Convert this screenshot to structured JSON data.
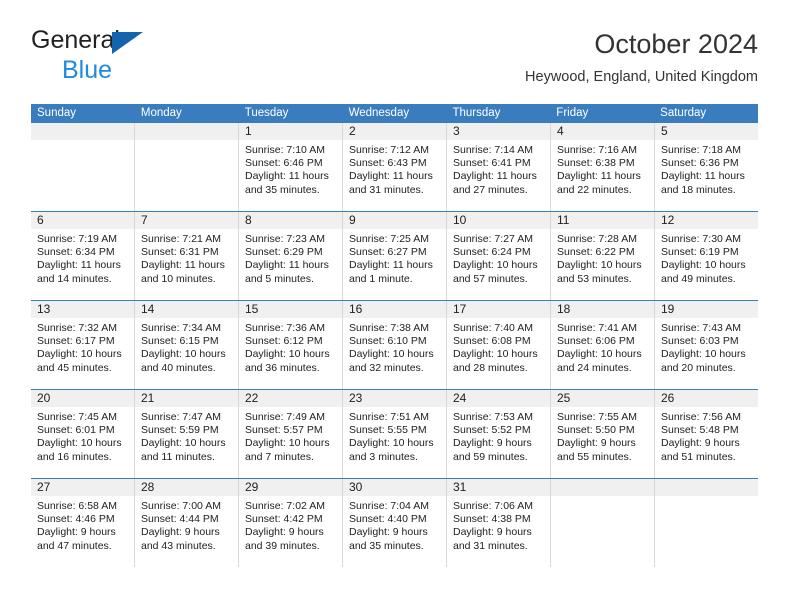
{
  "brand": {
    "line1": "General",
    "line2": "Blue",
    "triangle_color": "#1464ad",
    "blue_text_color": "#1e8ae0"
  },
  "header": {
    "title": "October 2024",
    "subtitle": "Heywood, England, United Kingdom"
  },
  "theme": {
    "header_blue": "#3a7dbf",
    "day_band_gray": "#f0f0f0",
    "cell_border": "#d8d8d8"
  },
  "calendar": {
    "weekday_headers": [
      "Sunday",
      "Monday",
      "Tuesday",
      "Wednesday",
      "Thursday",
      "Friday",
      "Saturday"
    ],
    "weeks": [
      [
        {
          "day": "",
          "empty": true
        },
        {
          "day": "",
          "empty": true
        },
        {
          "day": "1",
          "sunrise": "Sunrise: 7:10 AM",
          "sunset": "Sunset: 6:46 PM",
          "daylight1": "Daylight: 11 hours",
          "daylight2": "and 35 minutes."
        },
        {
          "day": "2",
          "sunrise": "Sunrise: 7:12 AM",
          "sunset": "Sunset: 6:43 PM",
          "daylight1": "Daylight: 11 hours",
          "daylight2": "and 31 minutes."
        },
        {
          "day": "3",
          "sunrise": "Sunrise: 7:14 AM",
          "sunset": "Sunset: 6:41 PM",
          "daylight1": "Daylight: 11 hours",
          "daylight2": "and 27 minutes."
        },
        {
          "day": "4",
          "sunrise": "Sunrise: 7:16 AM",
          "sunset": "Sunset: 6:38 PM",
          "daylight1": "Daylight: 11 hours",
          "daylight2": "and 22 minutes."
        },
        {
          "day": "5",
          "sunrise": "Sunrise: 7:18 AM",
          "sunset": "Sunset: 6:36 PM",
          "daylight1": "Daylight: 11 hours",
          "daylight2": "and 18 minutes."
        }
      ],
      [
        {
          "day": "6",
          "sunrise": "Sunrise: 7:19 AM",
          "sunset": "Sunset: 6:34 PM",
          "daylight1": "Daylight: 11 hours",
          "daylight2": "and 14 minutes."
        },
        {
          "day": "7",
          "sunrise": "Sunrise: 7:21 AM",
          "sunset": "Sunset: 6:31 PM",
          "daylight1": "Daylight: 11 hours",
          "daylight2": "and 10 minutes."
        },
        {
          "day": "8",
          "sunrise": "Sunrise: 7:23 AM",
          "sunset": "Sunset: 6:29 PM",
          "daylight1": "Daylight: 11 hours",
          "daylight2": "and 5 minutes."
        },
        {
          "day": "9",
          "sunrise": "Sunrise: 7:25 AM",
          "sunset": "Sunset: 6:27 PM",
          "daylight1": "Daylight: 11 hours",
          "daylight2": "and 1 minute."
        },
        {
          "day": "10",
          "sunrise": "Sunrise: 7:27 AM",
          "sunset": "Sunset: 6:24 PM",
          "daylight1": "Daylight: 10 hours",
          "daylight2": "and 57 minutes."
        },
        {
          "day": "11",
          "sunrise": "Sunrise: 7:28 AM",
          "sunset": "Sunset: 6:22 PM",
          "daylight1": "Daylight: 10 hours",
          "daylight2": "and 53 minutes."
        },
        {
          "day": "12",
          "sunrise": "Sunrise: 7:30 AM",
          "sunset": "Sunset: 6:19 PM",
          "daylight1": "Daylight: 10 hours",
          "daylight2": "and 49 minutes."
        }
      ],
      [
        {
          "day": "13",
          "sunrise": "Sunrise: 7:32 AM",
          "sunset": "Sunset: 6:17 PM",
          "daylight1": "Daylight: 10 hours",
          "daylight2": "and 45 minutes."
        },
        {
          "day": "14",
          "sunrise": "Sunrise: 7:34 AM",
          "sunset": "Sunset: 6:15 PM",
          "daylight1": "Daylight: 10 hours",
          "daylight2": "and 40 minutes."
        },
        {
          "day": "15",
          "sunrise": "Sunrise: 7:36 AM",
          "sunset": "Sunset: 6:12 PM",
          "daylight1": "Daylight: 10 hours",
          "daylight2": "and 36 minutes."
        },
        {
          "day": "16",
          "sunrise": "Sunrise: 7:38 AM",
          "sunset": "Sunset: 6:10 PM",
          "daylight1": "Daylight: 10 hours",
          "daylight2": "and 32 minutes."
        },
        {
          "day": "17",
          "sunrise": "Sunrise: 7:40 AM",
          "sunset": "Sunset: 6:08 PM",
          "daylight1": "Daylight: 10 hours",
          "daylight2": "and 28 minutes."
        },
        {
          "day": "18",
          "sunrise": "Sunrise: 7:41 AM",
          "sunset": "Sunset: 6:06 PM",
          "daylight1": "Daylight: 10 hours",
          "daylight2": "and 24 minutes."
        },
        {
          "day": "19",
          "sunrise": "Sunrise: 7:43 AM",
          "sunset": "Sunset: 6:03 PM",
          "daylight1": "Daylight: 10 hours",
          "daylight2": "and 20 minutes."
        }
      ],
      [
        {
          "day": "20",
          "sunrise": "Sunrise: 7:45 AM",
          "sunset": "Sunset: 6:01 PM",
          "daylight1": "Daylight: 10 hours",
          "daylight2": "and 16 minutes."
        },
        {
          "day": "21",
          "sunrise": "Sunrise: 7:47 AM",
          "sunset": "Sunset: 5:59 PM",
          "daylight1": "Daylight: 10 hours",
          "daylight2": "and 11 minutes."
        },
        {
          "day": "22",
          "sunrise": "Sunrise: 7:49 AM",
          "sunset": "Sunset: 5:57 PM",
          "daylight1": "Daylight: 10 hours",
          "daylight2": "and 7 minutes."
        },
        {
          "day": "23",
          "sunrise": "Sunrise: 7:51 AM",
          "sunset": "Sunset: 5:55 PM",
          "daylight1": "Daylight: 10 hours",
          "daylight2": "and 3 minutes."
        },
        {
          "day": "24",
          "sunrise": "Sunrise: 7:53 AM",
          "sunset": "Sunset: 5:52 PM",
          "daylight1": "Daylight: 9 hours",
          "daylight2": "and 59 minutes."
        },
        {
          "day": "25",
          "sunrise": "Sunrise: 7:55 AM",
          "sunset": "Sunset: 5:50 PM",
          "daylight1": "Daylight: 9 hours",
          "daylight2": "and 55 minutes."
        },
        {
          "day": "26",
          "sunrise": "Sunrise: 7:56 AM",
          "sunset": "Sunset: 5:48 PM",
          "daylight1": "Daylight: 9 hours",
          "daylight2": "and 51 minutes."
        }
      ],
      [
        {
          "day": "27",
          "sunrise": "Sunrise: 6:58 AM",
          "sunset": "Sunset: 4:46 PM",
          "daylight1": "Daylight: 9 hours",
          "daylight2": "and 47 minutes."
        },
        {
          "day": "28",
          "sunrise": "Sunrise: 7:00 AM",
          "sunset": "Sunset: 4:44 PM",
          "daylight1": "Daylight: 9 hours",
          "daylight2": "and 43 minutes."
        },
        {
          "day": "29",
          "sunrise": "Sunrise: 7:02 AM",
          "sunset": "Sunset: 4:42 PM",
          "daylight1": "Daylight: 9 hours",
          "daylight2": "and 39 minutes."
        },
        {
          "day": "30",
          "sunrise": "Sunrise: 7:04 AM",
          "sunset": "Sunset: 4:40 PM",
          "daylight1": "Daylight: 9 hours",
          "daylight2": "and 35 minutes."
        },
        {
          "day": "31",
          "sunrise": "Sunrise: 7:06 AM",
          "sunset": "Sunset: 4:38 PM",
          "daylight1": "Daylight: 9 hours",
          "daylight2": "and 31 minutes."
        },
        {
          "day": "",
          "empty": true
        },
        {
          "day": "",
          "empty": true
        }
      ]
    ]
  }
}
